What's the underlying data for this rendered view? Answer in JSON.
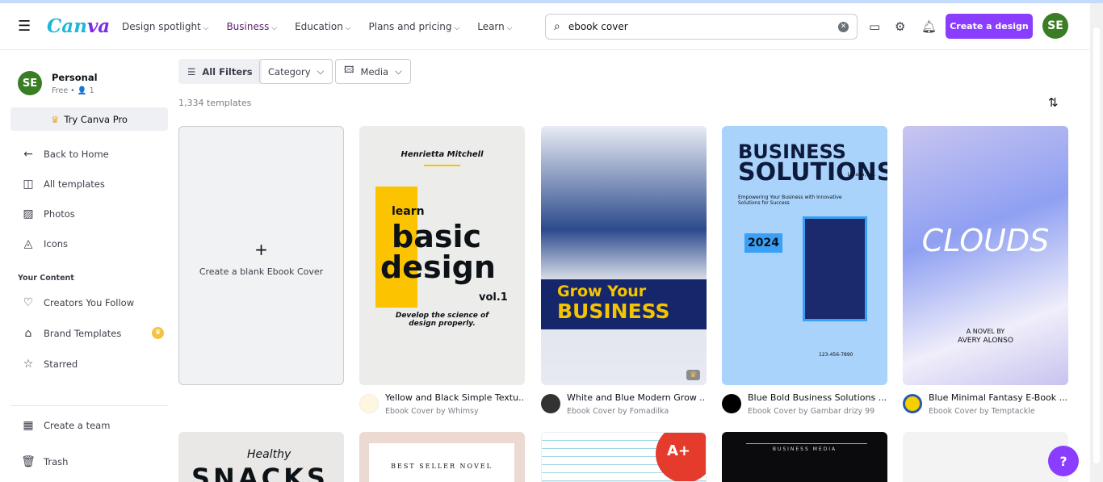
{
  "header": {
    "brand": "Canva",
    "nav": [
      "Design spotlight",
      "Business",
      "Education",
      "Plans and pricing",
      "Learn"
    ],
    "search_value": "ebook cover",
    "create_label": "Create a design",
    "avatar": "SE"
  },
  "sidebar": {
    "account_name": "Personal",
    "account_plan": "Free • 👤 1",
    "avatar": "SE",
    "pro_label": "Try Canva Pro",
    "items": [
      "Back to Home",
      "All templates",
      "Photos",
      "Icons"
    ],
    "section": "Your Content",
    "content_items": [
      "Creators You Follow",
      "Brand Templates",
      "Starred"
    ],
    "bottom": [
      "Create a team",
      "Trash"
    ]
  },
  "filters": {
    "all": "All Filters",
    "category": "Category",
    "media": "Media"
  },
  "count": "1,334 templates",
  "blank_label": "Create a blank Ebook Cover",
  "templates": [
    {
      "title": "Yellow and Black Simple Textu...",
      "sub": "Ebook Cover by Whimsy",
      "cover": [
        "Henrietta Mitchell",
        "learn",
        "basic",
        "design",
        "vol.1",
        "Develop the science of design properly."
      ]
    },
    {
      "title": "White and Blue Modern Grow ...",
      "sub": "Ebook Cover by Fomadilka",
      "cover": [
        "Grow Your",
        "BUSINESS"
      ]
    },
    {
      "title": "Blue Bold Business Solutions ...",
      "sub": "Ebook Cover by Gambar drizy 99",
      "cover": [
        "BUSINESS",
        "SOLUTIONS",
        "Empowering Your Business with Innovative Solutions for Success",
        "2024",
        "Larana, Inc.",
        "123-456-7890"
      ]
    },
    {
      "title": "Blue Minimal Fantasy E-Book ...",
      "sub": "Ebook Cover by Temptackle",
      "cover": [
        "CLOUDS",
        "A NOVEL BY",
        "AVERY ALONSO"
      ]
    }
  ],
  "row2_cover": [
    "Healthy",
    "SNACKS",
    "BEST SELLER NOVEL",
    "A+",
    "BUSINESS MEDIA"
  ],
  "help": "?"
}
